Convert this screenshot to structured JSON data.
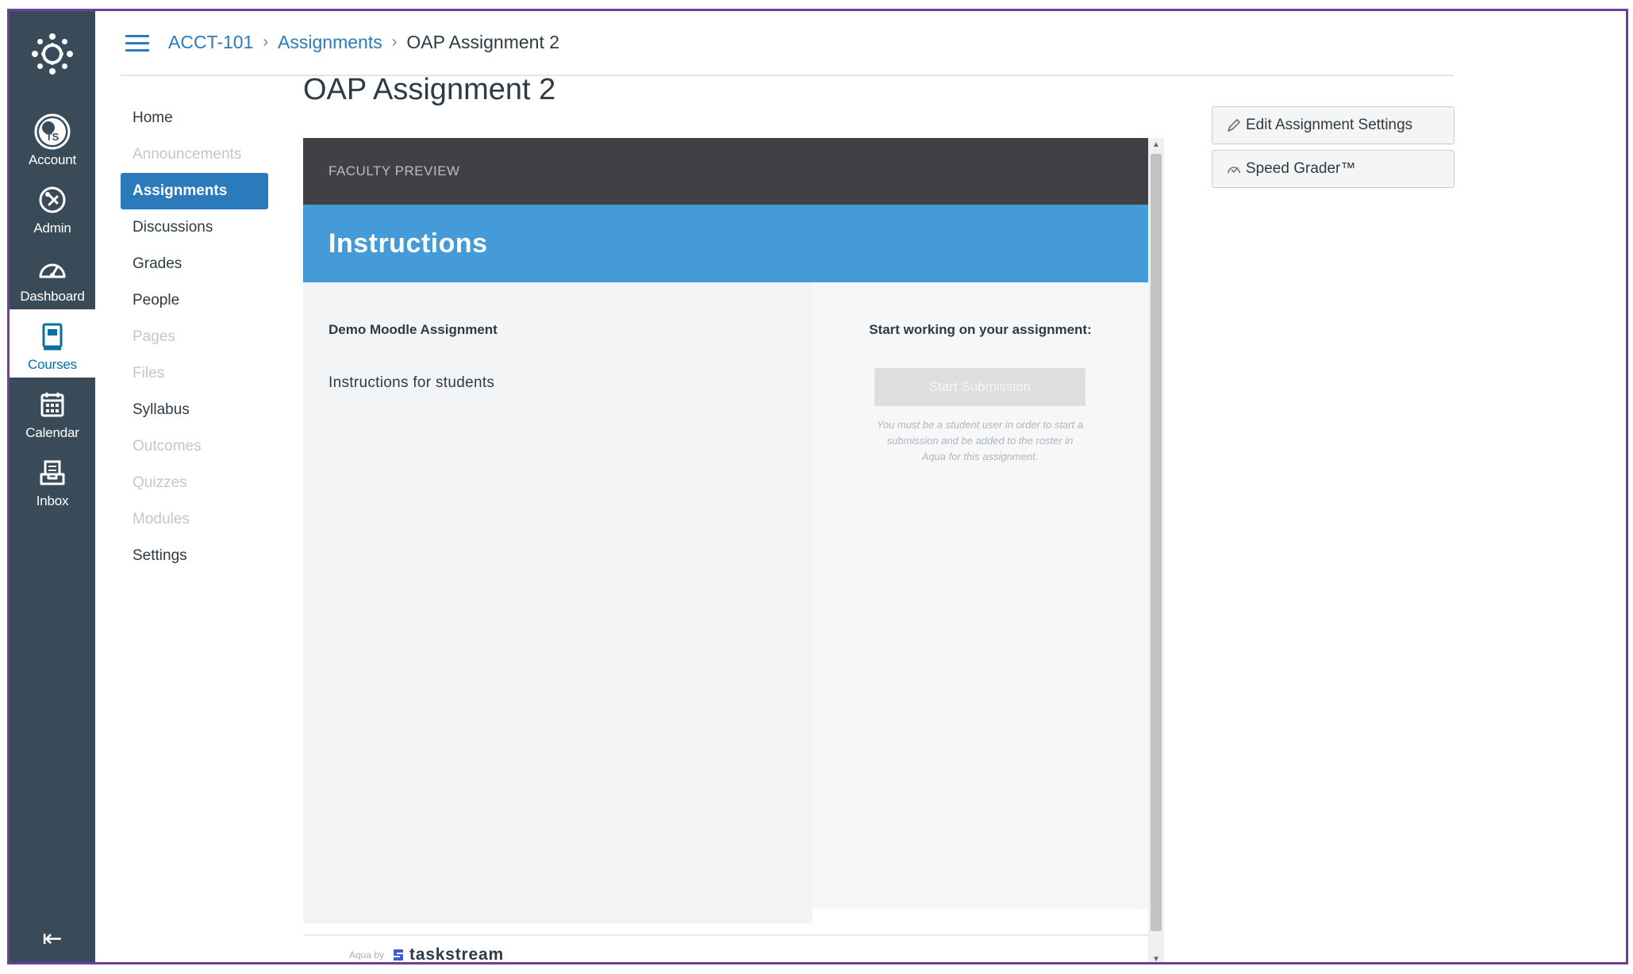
{
  "global_nav": {
    "logo_icon": "canvas-logo-icon",
    "items": [
      {
        "label": "Account",
        "icon": "account-avatar-icon",
        "avatar_text": "TS"
      },
      {
        "label": "Admin",
        "icon": "admin-shield-icon"
      },
      {
        "label": "Dashboard",
        "icon": "dashboard-gauge-icon"
      },
      {
        "label": "Courses",
        "icon": "courses-book-icon",
        "active": true
      },
      {
        "label": "Calendar",
        "icon": "calendar-icon"
      },
      {
        "label": "Inbox",
        "icon": "inbox-icon"
      }
    ],
    "collapse_glyph": "⇤"
  },
  "breadcrumb": {
    "course": "ACCT-101",
    "section": "Assignments",
    "current": "OAP Assignment 2",
    "sep": "›"
  },
  "course_nav": [
    {
      "label": "Home",
      "state": "enabled"
    },
    {
      "label": "Announcements",
      "state": "disabled"
    },
    {
      "label": "Assignments",
      "state": "active"
    },
    {
      "label": "Discussions",
      "state": "enabled"
    },
    {
      "label": "Grades",
      "state": "enabled"
    },
    {
      "label": "People",
      "state": "enabled"
    },
    {
      "label": "Pages",
      "state": "disabled"
    },
    {
      "label": "Files",
      "state": "disabled"
    },
    {
      "label": "Syllabus",
      "state": "enabled"
    },
    {
      "label": "Outcomes",
      "state": "disabled"
    },
    {
      "label": "Quizzes",
      "state": "disabled"
    },
    {
      "label": "Modules",
      "state": "disabled"
    },
    {
      "label": "Settings",
      "state": "enabled"
    }
  ],
  "page": {
    "title": "OAP Assignment 2"
  },
  "side_buttons": {
    "edit_settings": "Edit Assignment Settings",
    "speed_grader": "Speed Grader™"
  },
  "tool": {
    "preview_label": "FACULTY PREVIEW",
    "instructions_heading": "Instructions",
    "assignment_title": "Demo Moodle Assignment",
    "assignment_description": "Instructions for students",
    "start_heading": "Start working on your assignment:",
    "start_button": "Start Submission",
    "start_note": "You must be a student user in order to start a submission and be added to the roster in Aqua for this assignment.",
    "footer_prefix": "Aqua by",
    "footer_brand": "taskstream"
  },
  "colors": {
    "nav_bg": "#394b58",
    "link": "#2b7abc",
    "instructions_bar": "#449bd8",
    "preview_bar": "#3f4145",
    "frame": "#6b3fa0"
  }
}
